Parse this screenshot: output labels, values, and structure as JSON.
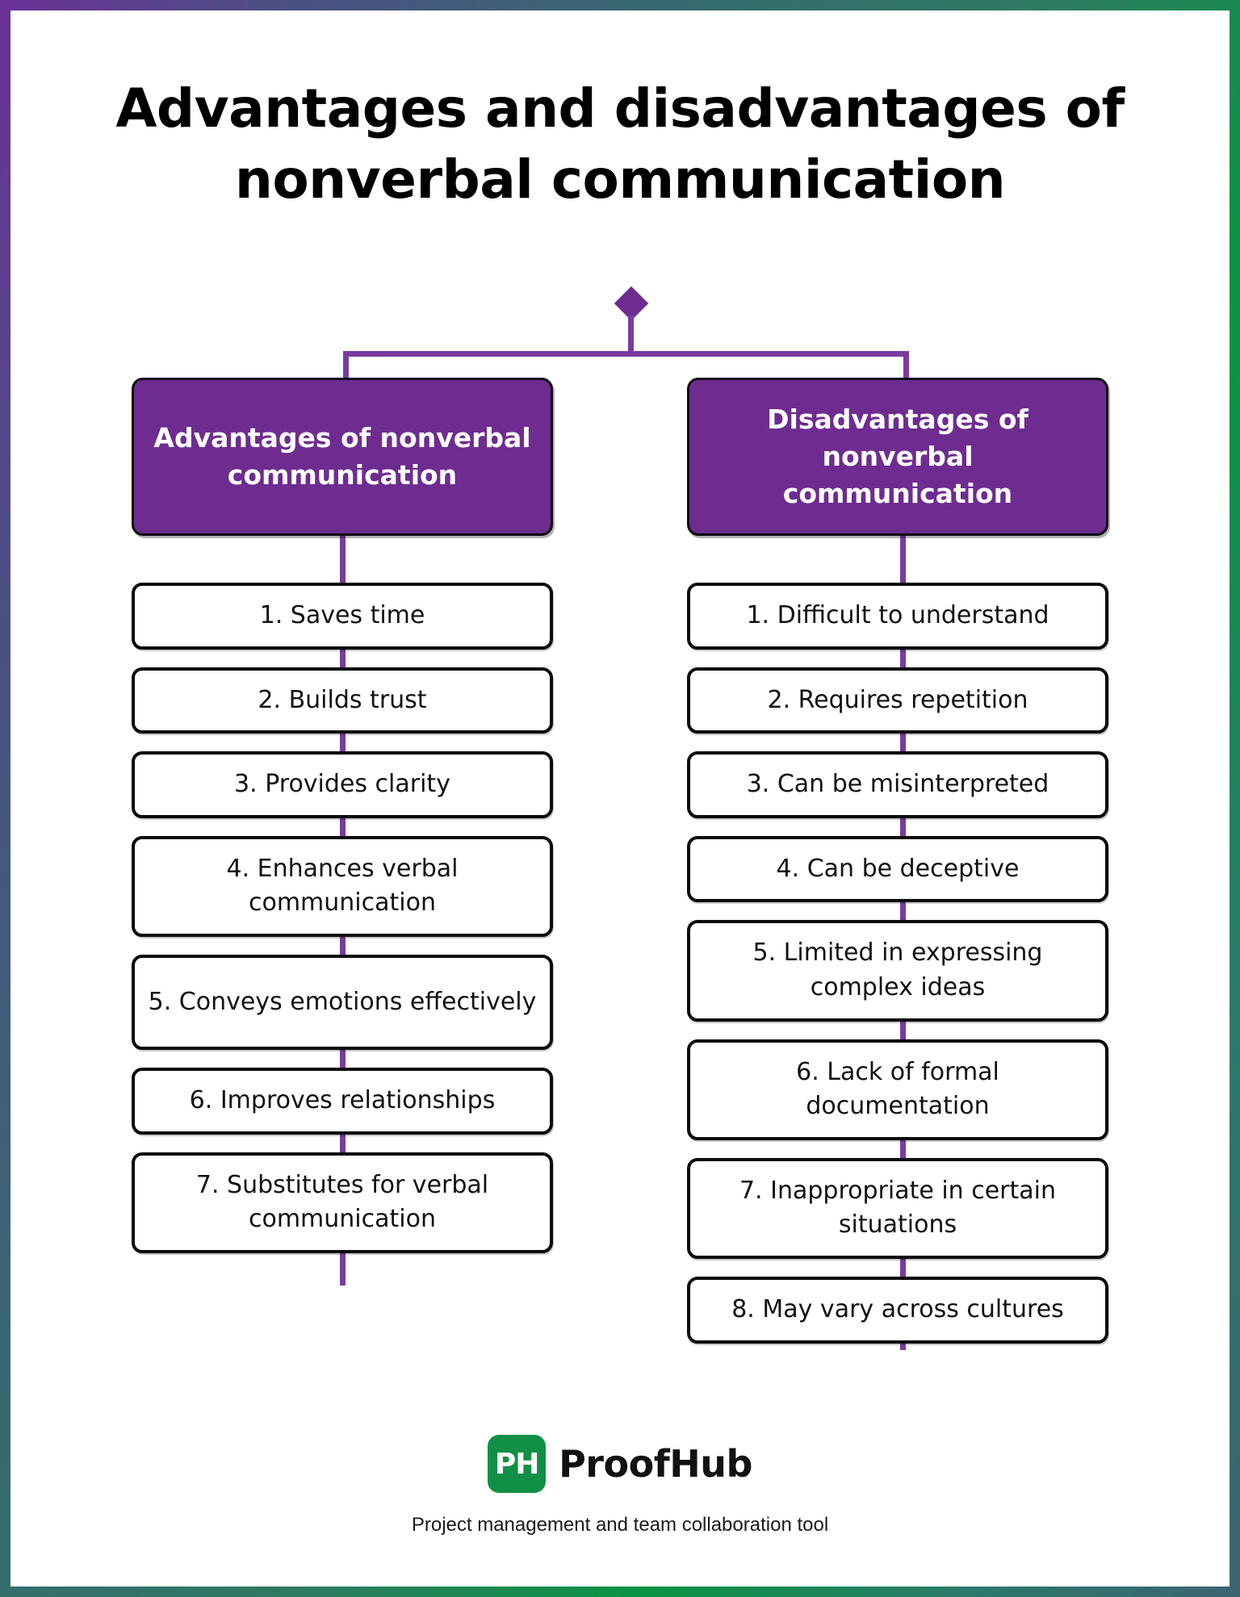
{
  "frame": {
    "gradient_colors": [
      "#6B3097",
      "#366A70",
      "#0A9444",
      "#3C6472"
    ]
  },
  "title": "Advantages and disadvantages of nonverbal communication",
  "theme": {
    "purple": "#6E2C91",
    "connector_purple": "#7A3B9E",
    "box_border": "#0b0b0b",
    "brand_green": "#119045"
  },
  "columns": [
    {
      "id": "advantages",
      "heading": "Advantages of nonverbal communication",
      "items": [
        "1. Saves time",
        "2. Builds trust",
        "3. Provides clarity",
        "4. Enhances verbal communication",
        "5. Conveys emotions effectively",
        "6. Improves relationships",
        "7. Substitutes for verbal communication"
      ]
    },
    {
      "id": "disadvantages",
      "heading": "Disadvantages of nonverbal communication",
      "items": [
        "1. Difficult to understand",
        "2. Requires repetition",
        "3. Can be misinterpreted",
        "4. Can be deceptive",
        "5. Limited in expressing complex ideas",
        "6. Lack of formal documentation",
        "7. Inappropriate in certain situations",
        "8. May vary across cultures"
      ]
    }
  ],
  "footer": {
    "logo_mark": "PH",
    "logo_word": "ProofHub",
    "tagline": "Project management and team collaboration tool"
  }
}
